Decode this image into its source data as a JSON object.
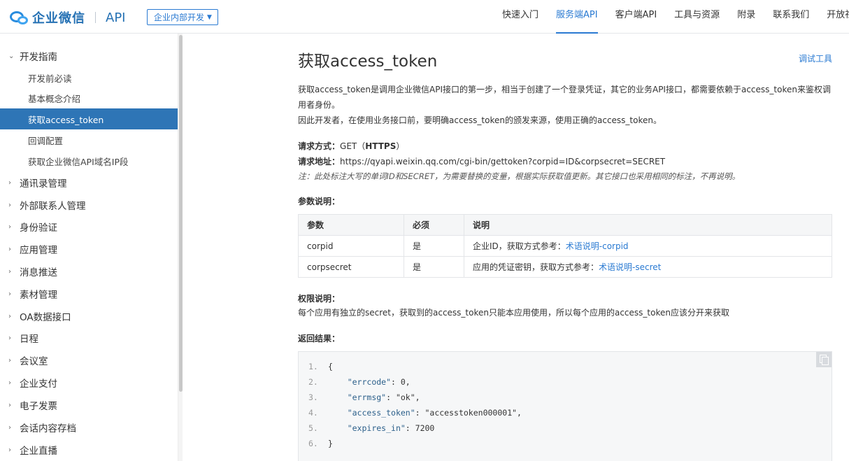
{
  "header": {
    "logo_text": "企业微信",
    "logo_api": "API",
    "scope_select": "企业内部开发",
    "nav": [
      "快速入门",
      "服务端API",
      "客户端API",
      "工具与资源",
      "附录",
      "联系我们",
      "开放社区"
    ],
    "active_nav": "服务端API"
  },
  "sidebar": {
    "group_open": "开发指南",
    "children": [
      "开发前必读",
      "基本概念介绍",
      "获取access_token",
      "回调配置",
      "获取企业微信API域名IP段"
    ],
    "active_child": "获取access_token",
    "groups": [
      "通讯录管理",
      "外部联系人管理",
      "身份验证",
      "应用管理",
      "消息推送",
      "素材管理",
      "OA数据接口",
      "日程",
      "会议室",
      "企业支付",
      "电子发票",
      "会话内容存档",
      "企业直播"
    ]
  },
  "main": {
    "title": "获取access_token",
    "debug_link": "调试工具",
    "intro1": "获取access_token是调用企业微信API接口的第一步，相当于创建了一个登录凭证，其它的业务API接口，都需要依赖于access_token来鉴权调用者身份。",
    "intro2": "因此开发者，在使用业务接口前，要明确access_token的颁发来源，使用正确的access_token。",
    "method_label": "请求方式：",
    "method_value": "GET（",
    "method_bold": "HTTPS",
    "method_close": "）",
    "url_label": "请求地址：",
    "url_value": "https://qyapi.weixin.qq.com/cgi-bin/gettoken?corpid=ID&corpsecret=SECRET",
    "note": "注：此处标注大写的单词ID和SECRET，为需要替换的变量，根据实际获取值更新。其它接口也采用相同的标注，不再说明。",
    "params_title": "参数说明：",
    "params_headers": [
      "参数",
      "必须",
      "说明"
    ],
    "params_rows": [
      {
        "name": "corpid",
        "required": "是",
        "desc": "企业ID，获取方式参考：",
        "link": "术语说明-corpid"
      },
      {
        "name": "corpsecret",
        "required": "是",
        "desc": "应用的凭证密钥，获取方式参考：",
        "link": "术语说明-secret"
      }
    ],
    "perm_title": "权限说明：",
    "perm_text": "每个应用有独立的secret，获取到的access_token只能本应用使用，所以每个应用的access_token应该分开来获取",
    "result_title": "返回结果：",
    "code_lines": [
      {
        "n": "1.",
        "text": "{"
      },
      {
        "n": "2.",
        "key": "\"errcode\"",
        "rest": ": 0,"
      },
      {
        "n": "3.",
        "key": "\"errmsg\"",
        "rest": ": \"ok\","
      },
      {
        "n": "4.",
        "key": "\"access_token\"",
        "rest": ": \"accesstoken000001\","
      },
      {
        "n": "5.",
        "key": "\"expires_in\"",
        "rest": ": 7200"
      },
      {
        "n": "6.",
        "text": "}"
      }
    ]
  }
}
